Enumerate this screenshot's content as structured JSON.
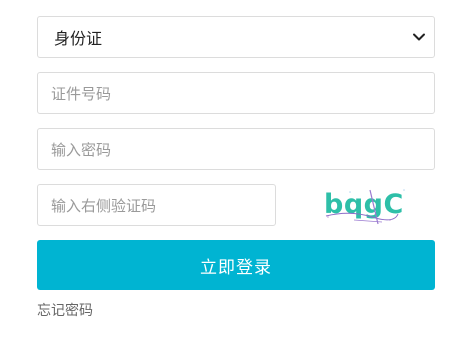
{
  "form": {
    "id_type": {
      "selected": "身份证",
      "icon": "chevron-down-icon"
    },
    "id_number": {
      "placeholder": "证件号码"
    },
    "password": {
      "placeholder": "输入密码"
    },
    "captcha_input": {
      "placeholder": "输入右侧验证码"
    },
    "captcha_image": {
      "text": "bqgC"
    },
    "login_button": {
      "label": "立即登录"
    },
    "forgot_link": {
      "label": "忘记密码"
    }
  },
  "colors": {
    "primary": "#00b4d2",
    "captcha_text": "#2ebfa8",
    "border": "#dcdcdc",
    "placeholder": "#9a9a9a"
  }
}
